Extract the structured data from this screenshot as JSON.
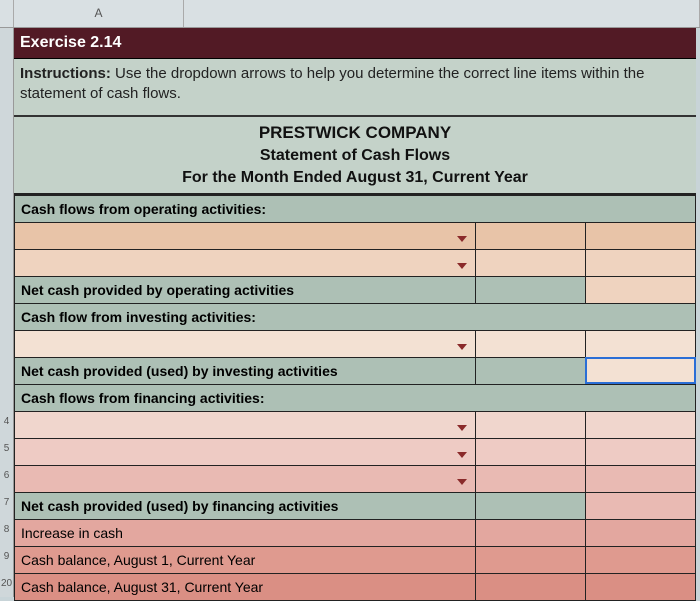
{
  "columnHeader": "A",
  "rowNumbers": [
    "4",
    "5",
    "6",
    "7",
    "8",
    "9",
    "20"
  ],
  "exerciseTitle": "Exercise 2.14",
  "instructionsLabel": "Instructions:",
  "instructionsText": " Use the dropdown arrows to help you determine the correct line items within the statement of cash flows.",
  "company": "PRESTWICK COMPANY",
  "statementTitle": "Statement of Cash Flows",
  "period": "For the Month Ended August 31, Current Year",
  "sections": {
    "opHeader": "Cash flows from operating activities:",
    "opNet": "Net cash provided by operating activities",
    "invHeader": "Cash flow from investing activities:",
    "invNet": "Net cash provided (used) by investing activities",
    "finHeader": "Cash flows from financing activities:",
    "finNet": "Net cash provided (used) by financing activities",
    "increase": "Increase in cash",
    "beginBal": "Cash balance, August 1, Current Year",
    "endBal": "Cash balance, August 31, Current Year"
  }
}
